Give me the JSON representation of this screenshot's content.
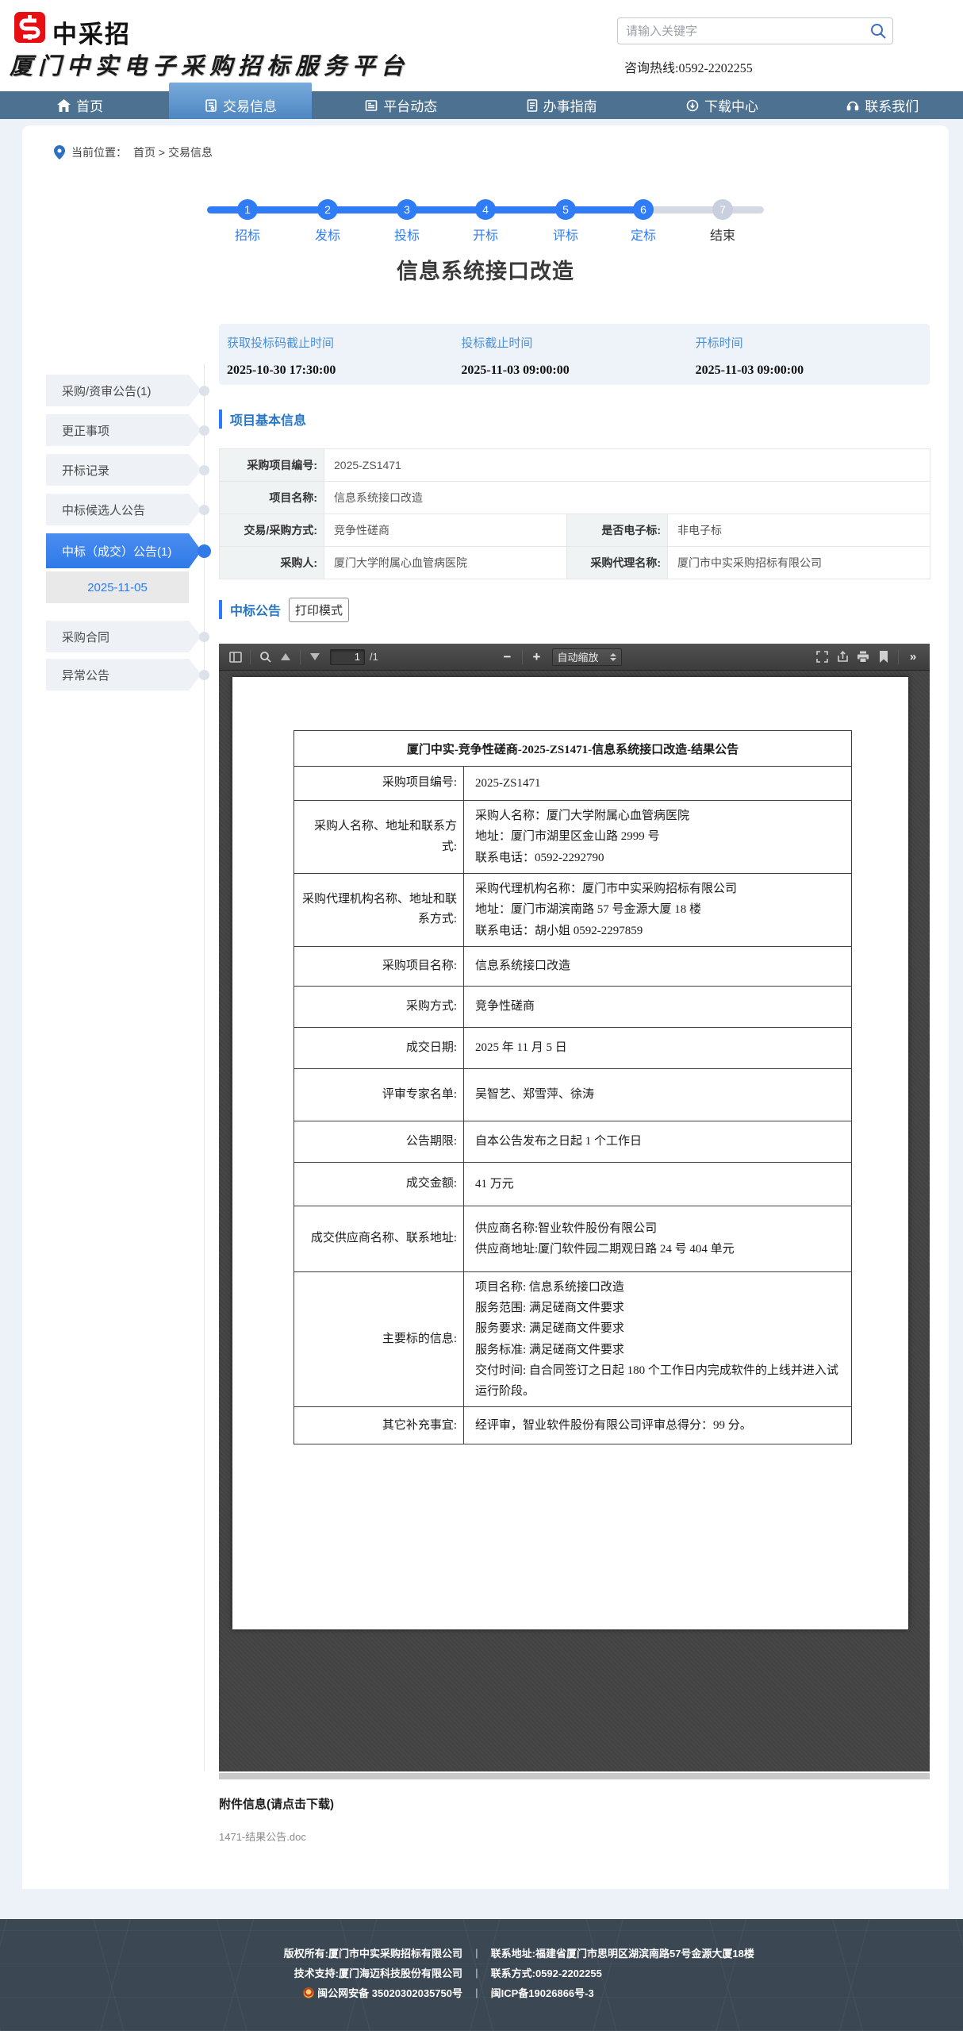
{
  "header": {
    "logo_text": "中采招",
    "subtitle": "厦门中实电子采购招标服务平台",
    "search_placeholder": "请输入关键字",
    "hotline": "咨询热线:0592-2202255"
  },
  "nav": {
    "items": [
      {
        "label": "首页"
      },
      {
        "label": "交易信息"
      },
      {
        "label": "平台动态"
      },
      {
        "label": "办事指南"
      },
      {
        "label": "下载中心"
      },
      {
        "label": "联系我们"
      }
    ]
  },
  "breadcrumb": {
    "label": "当前位置：",
    "path": "首页 > 交易信息"
  },
  "steps": [
    {
      "num": "1",
      "label": "招标"
    },
    {
      "num": "2",
      "label": "发标"
    },
    {
      "num": "3",
      "label": "投标"
    },
    {
      "num": "4",
      "label": "开标"
    },
    {
      "num": "5",
      "label": "评标"
    },
    {
      "num": "6",
      "label": "定标"
    },
    {
      "num": "7",
      "label": "结束"
    }
  ],
  "page_title": "信息系统接口改造",
  "time_box": [
    {
      "label": "获取投标码截止时间",
      "value": "2025-10-30 17:30:00"
    },
    {
      "label": "投标截止时间",
      "value": "2025-11-03 09:00:00"
    },
    {
      "label": "开标时间",
      "value": "2025-11-03 09:00:00"
    }
  ],
  "sidebar": [
    {
      "label": "采购/资审公告(1)"
    },
    {
      "label": "更正事项"
    },
    {
      "label": "开标记录"
    },
    {
      "label": "中标候选人公告"
    },
    {
      "label": "中标（成交）公告(1)"
    },
    {
      "label": "2025-11-05"
    },
    {
      "label": "采购合同"
    },
    {
      "label": "异常公告"
    }
  ],
  "basic_info": {
    "section_title": "项目基本信息",
    "rows": [
      [
        {
          "label": "采购项目编号:",
          "value": "2025-ZS1471"
        }
      ],
      [
        {
          "label": "项目名称:",
          "value": "信息系统接口改造"
        }
      ],
      [
        {
          "label": "交易/采购方式:",
          "value": "竞争性磋商"
        },
        {
          "label": "是否电子标:",
          "value": "非电子标"
        }
      ],
      [
        {
          "label": "采购人:",
          "value": "厦门大学附属心血管病医院"
        },
        {
          "label": "采购代理名称:",
          "value": "厦门市中实采购招标有限公司"
        }
      ]
    ]
  },
  "announcement": {
    "section_title": "中标公告",
    "print_button": "打印模式"
  },
  "pdf_toolbar": {
    "page_value": "1",
    "page_total": "/1",
    "zoom_label": "自动缩放",
    "minus": "−",
    "plus": "+",
    "more": "»"
  },
  "pdf_doc": {
    "title": "厦门中实-竞争性磋商-2025-ZS1471-信息系统接口改造-结果公告",
    "rows": [
      {
        "label": "采购项目编号:",
        "lines": [
          "2025-ZS1471"
        ]
      },
      {
        "label": "采购人名称、地址和联系方式:",
        "lines": [
          "采购人名称：厦门大学附属心血管病医院",
          "地址：厦门市湖里区金山路 2999 号",
          "联系电话：0592-2292790"
        ]
      },
      {
        "label": "采购代理机构名称、地址和联系方式:",
        "lines": [
          "采购代理机构名称：厦门市中实采购招标有限公司",
          "地址：厦门市湖滨南路 57 号金源大厦 18 楼",
          "联系电话：胡小姐 0592-2297859"
        ]
      },
      {
        "label": "采购项目名称:",
        "lines": [
          "信息系统接口改造"
        ]
      },
      {
        "label": "采购方式:",
        "lines": [
          "竞争性磋商"
        ]
      },
      {
        "label": "成交日期:",
        "lines": [
          "2025 年 11 月 5 日"
        ]
      },
      {
        "label": "评审专家名单:",
        "lines": [
          "吴智艺、郑雪萍、徐涛"
        ]
      },
      {
        "label": "公告期限:",
        "lines": [
          "自本公告发布之日起 1 个工作日"
        ]
      },
      {
        "label": "成交金额:",
        "lines": [
          "41 万元"
        ]
      },
      {
        "label": "成交供应商名称、联系地址:",
        "lines": [
          "供应商名称:智业软件股份有限公司",
          "供应商地址:厦门软件园二期观日路 24 号 404 单元"
        ]
      },
      {
        "label": "主要标的信息:",
        "lines": [
          "项目名称: 信息系统接口改造",
          "服务范围: 满足磋商文件要求",
          "服务要求: 满足磋商文件要求",
          "服务标准: 满足磋商文件要求",
          "交付时间: 自合同签订之日起 180 个工作日内完成软件的上线并进入试运行阶段。"
        ]
      },
      {
        "label": "其它补充事宜:",
        "lines": [
          "经评审，智业软件股份有限公司评审总得分：99 分。"
        ]
      }
    ]
  },
  "attachments": {
    "title": "附件信息(请点击下载)",
    "file": "1471-结果公告.doc"
  },
  "footer": {
    "rows": [
      {
        "left": "版权所有:厦门市中实采购招标有限公司",
        "right": "联系地址:福建省厦门市思明区湖滨南路57号金源大厦18楼"
      },
      {
        "left": "技术支持:厦门海迈科技股份有限公司",
        "right": "联系方式:0592-2202255"
      },
      {
        "left": "闽公网安备 35020302035750号",
        "right": "闽ICP备19026866号-3"
      }
    ]
  }
}
